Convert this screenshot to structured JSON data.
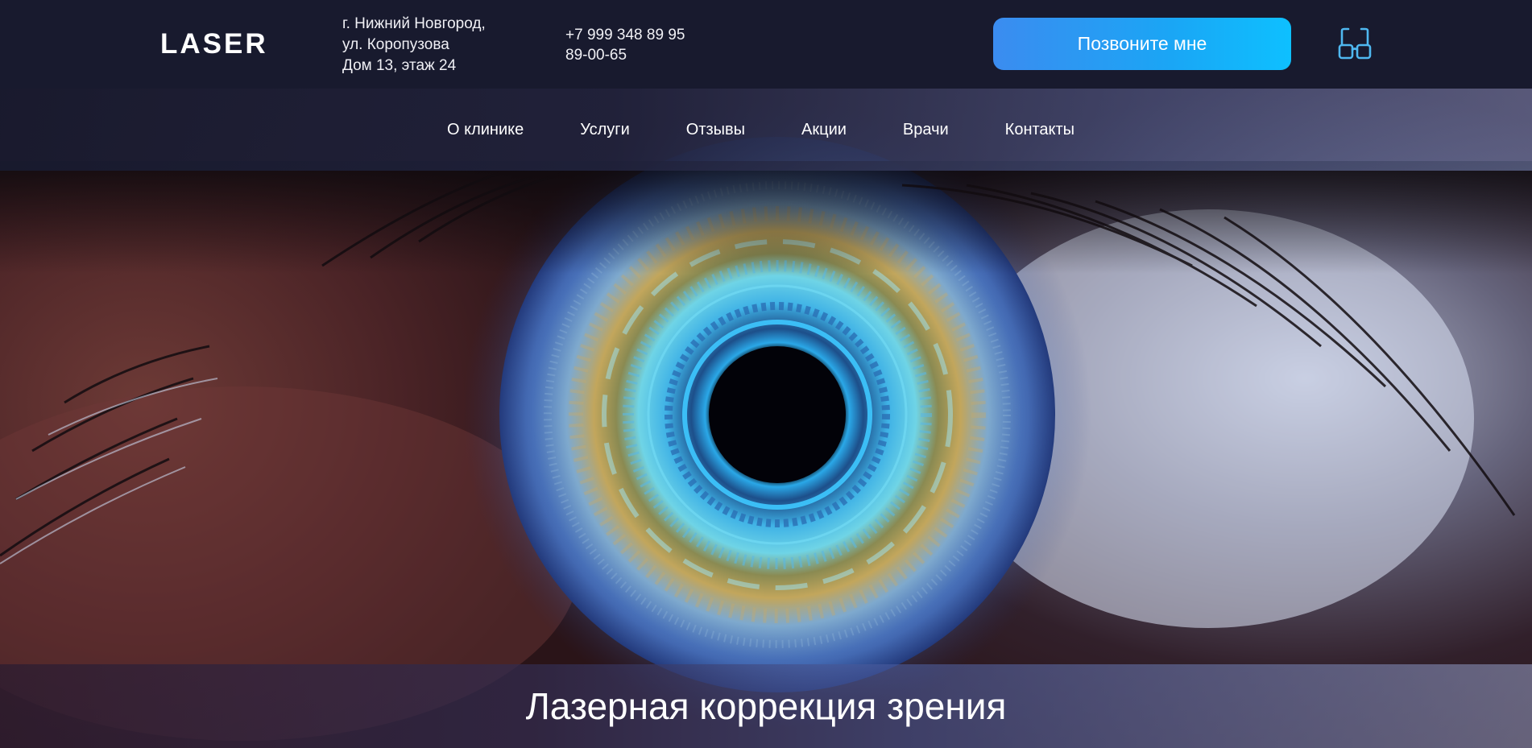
{
  "header": {
    "logo_text": "LASER",
    "address_lines": [
      "г. Нижний Новгород,",
      "ул. Коропузова",
      "Дом 13, этаж 24"
    ],
    "phone_lines": [
      "+7 999 348 89 95",
      "89-00-65"
    ],
    "call_button_label": "Позвоните мне",
    "accessibility_icon": "glasses-icon"
  },
  "nav": {
    "items": [
      {
        "label": "О клинике"
      },
      {
        "label": "Услуги"
      },
      {
        "label": "Отзывы"
      },
      {
        "label": "Акции"
      },
      {
        "label": "Врачи"
      },
      {
        "label": "Контакты"
      }
    ]
  },
  "hero": {
    "title": "Лазерная коррекция зрения",
    "image": "eye-closeup-image"
  },
  "colors": {
    "topbar_bg": "#181a2e",
    "button_gradient_start": "#3b8cf0",
    "button_gradient_end": "#0ec0ff",
    "icon_color": "#4fb8f0"
  }
}
